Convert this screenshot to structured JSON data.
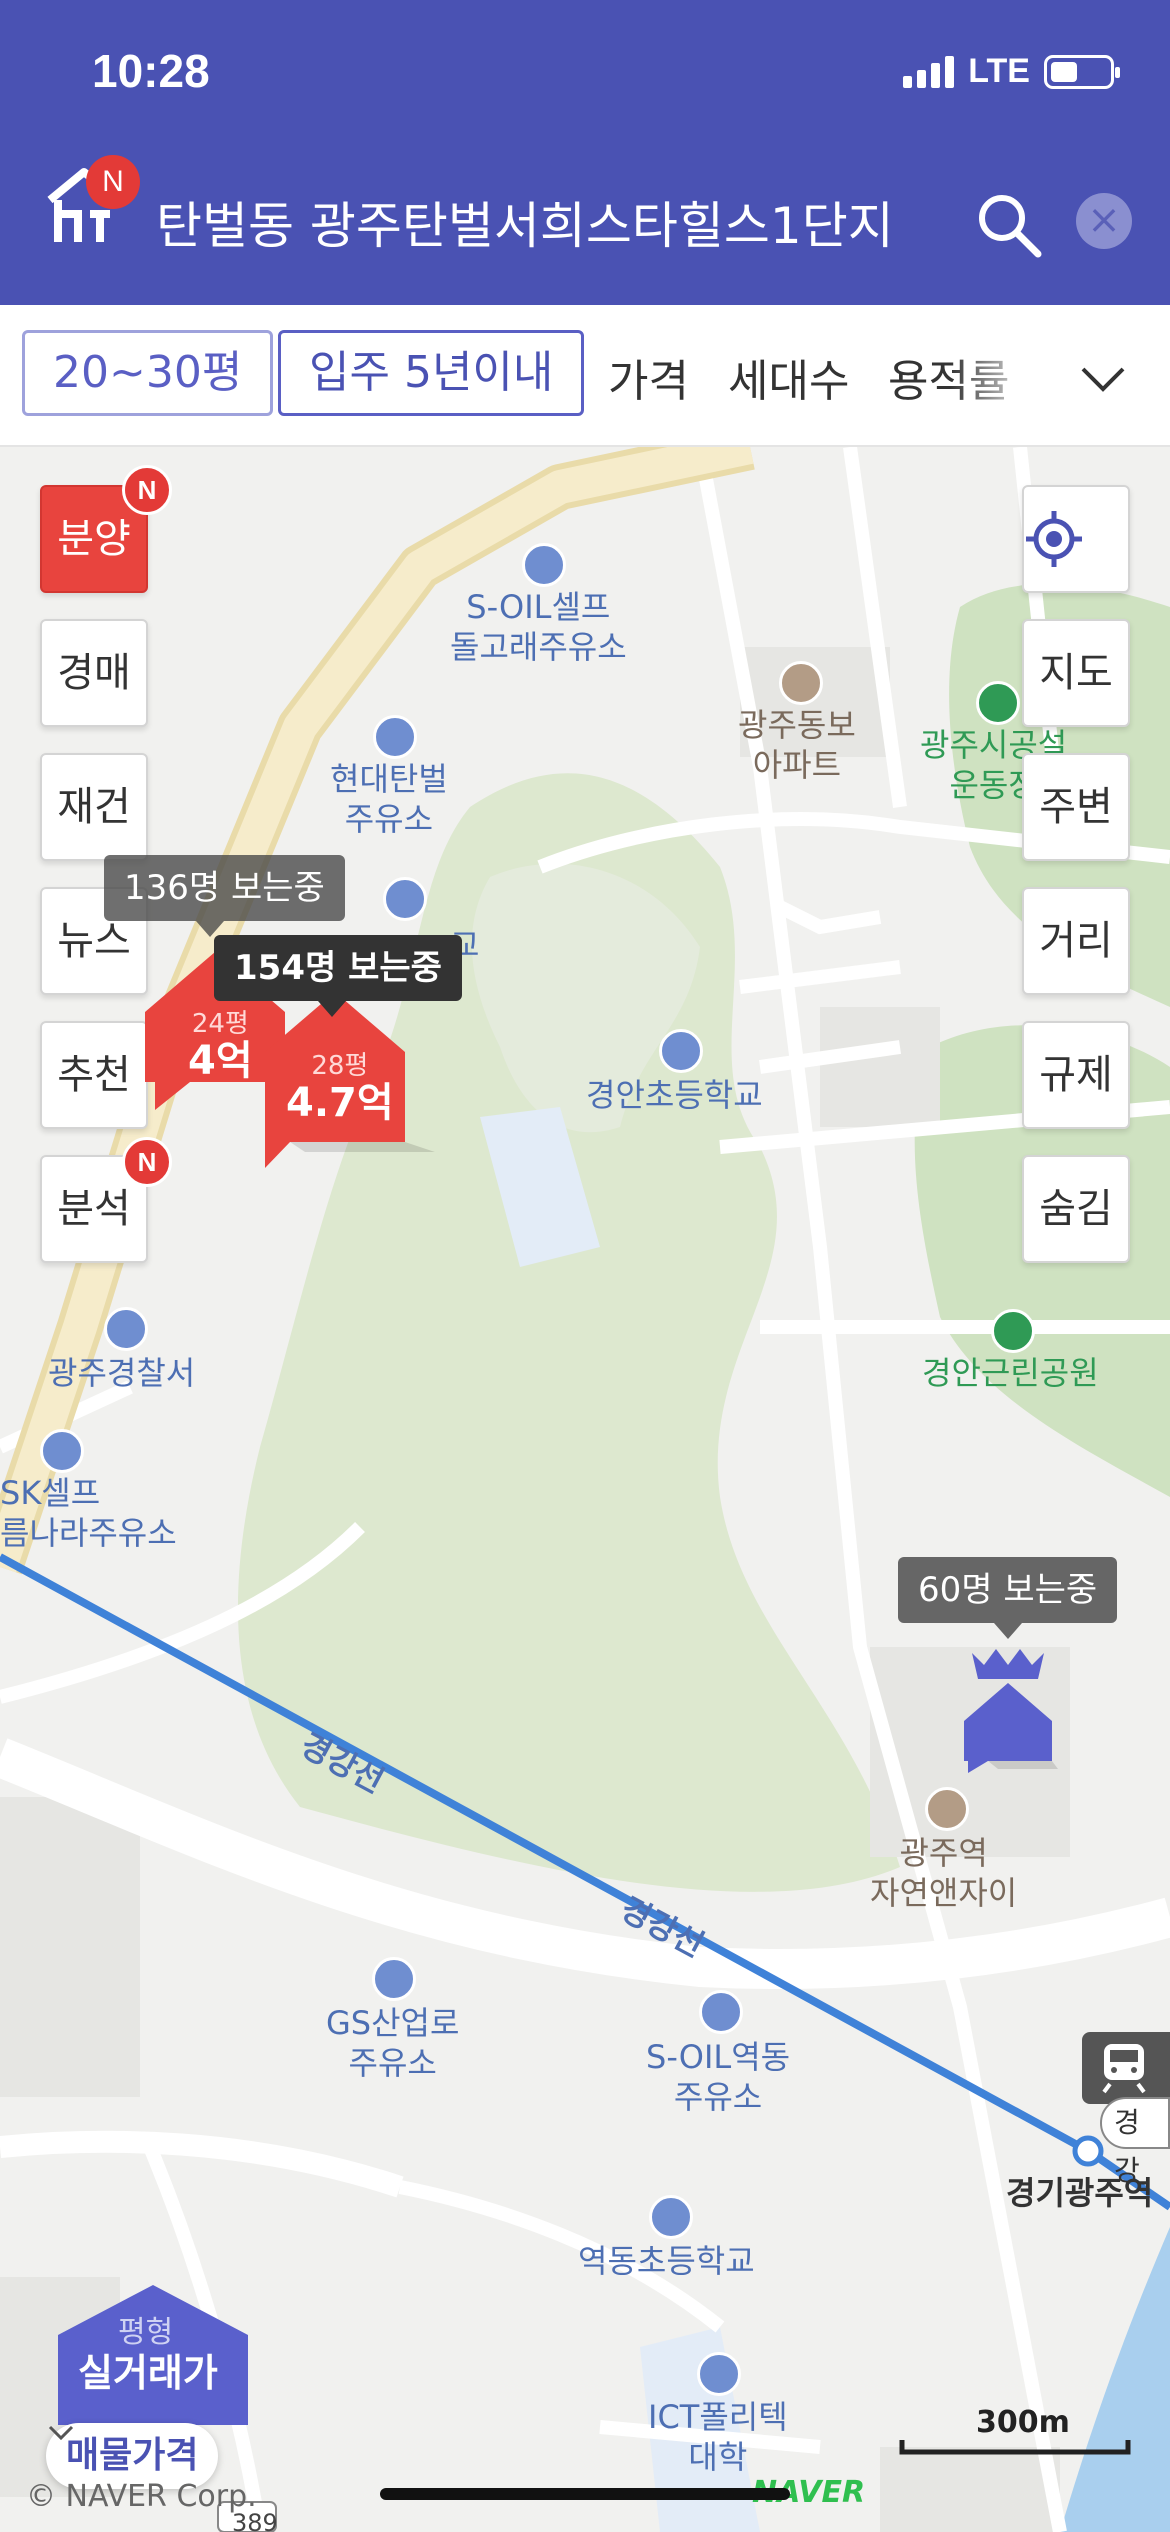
{
  "status_bar": {
    "time": "10:28",
    "network": "LTE"
  },
  "header": {
    "logo_badge": "N",
    "search_query": "탄벌동 광주탄벌서희스타힐스1단지",
    "clear_symbol": "×"
  },
  "filters": {
    "chips": [
      "20~30평",
      "입주 5년이내"
    ],
    "options": [
      "가격",
      "세대수",
      "용적률"
    ]
  },
  "left_menu": {
    "items": [
      "분양",
      "경매",
      "재건",
      "뉴스",
      "추천",
      "분석"
    ],
    "new_badge": "N"
  },
  "right_menu": {
    "items": [
      "지도",
      "주변",
      "거리",
      "규제",
      "숨김"
    ]
  },
  "map": {
    "pois": {
      "s_oil_1": "S-OIL셀프\n돌고래주유소",
      "hyundai": "현대탄벌\n주유소",
      "dongbo": "광주동보\n아파트",
      "stadium": "광주시공설\n운동장",
      "gyeongan_elem": "경안초등학교",
      "police": "광주경찰서",
      "sk": "SK셀프\n름나라주유소",
      "gyeongan_park": "경안근린공원",
      "xi": "광주역\n자연앤자이",
      "gs": "GS산업로\n주유소",
      "s_oil_2": "S-OIL역동\n주유소",
      "yeokdong_elem": "역동초등학교",
      "ict": "ICT폴리텍\n대학",
      "station": "경기광주역",
      "line1": "경강선",
      "line2": "경강선",
      "line_badge": "경강",
      "school_fragment": "교",
      "road_num": "389"
    },
    "tooltips": {
      "t1": "136명 보는중",
      "t2": "154명 보는중",
      "t3": "60명 보는중"
    },
    "markers": {
      "m1": {
        "size": "24평",
        "price": "4억"
      },
      "m2": {
        "size": "28평",
        "price": "4.7억"
      }
    },
    "price_panel": {
      "label_small": "평형",
      "label_big": "실거래가",
      "dropdown": "매물가격"
    },
    "scale": "300m",
    "copyright": "© NAVER Corp.",
    "naver_logo": "NAVER"
  },
  "colors": {
    "brand": "#4a52b3",
    "accent_red": "#e8443e"
  }
}
